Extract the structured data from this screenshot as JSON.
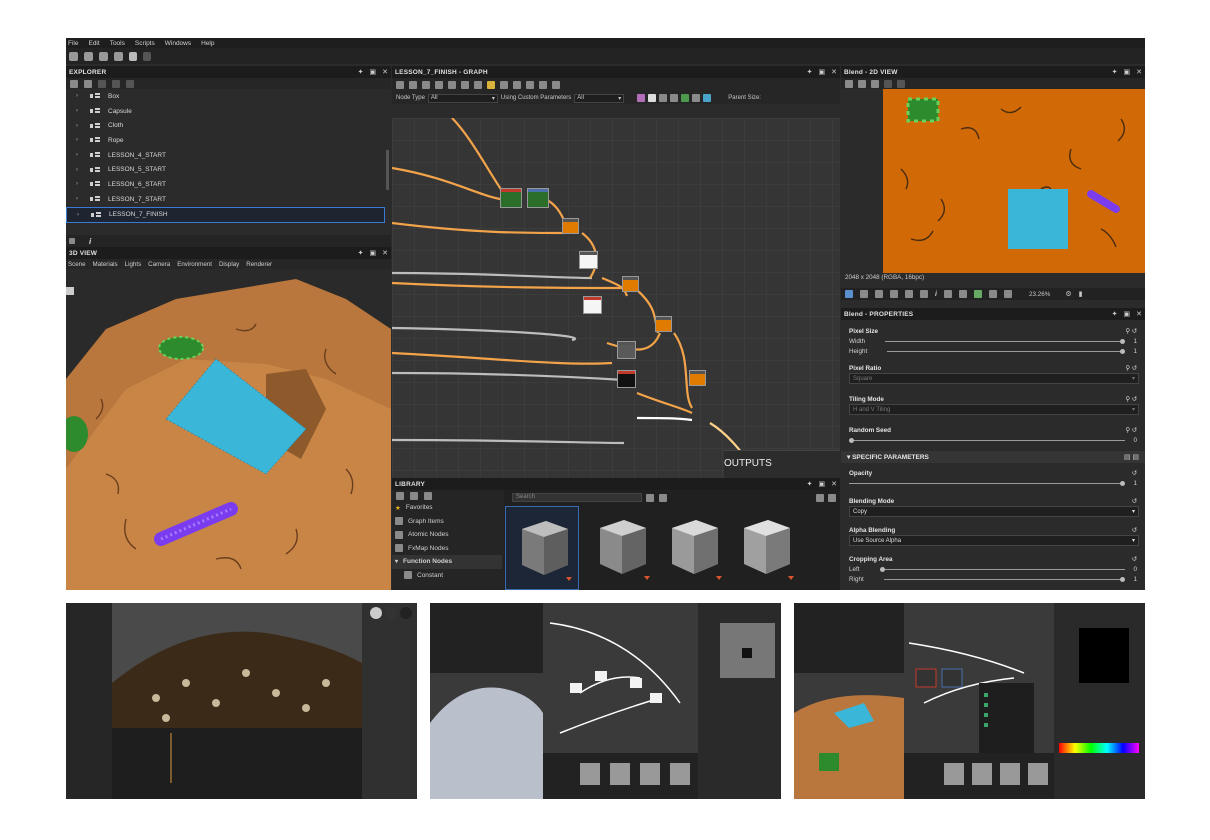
{
  "menu": [
    "File",
    "Edit",
    "Tools",
    "Scripts",
    "Windows",
    "Help"
  ],
  "explorer": {
    "title": "EXPLORER",
    "items": [
      "Box",
      "Capsule",
      "Cloth",
      "Rope",
      "LESSON_4_START",
      "LESSON_5_START",
      "LESSON_6_START",
      "LESSON_7_START",
      "LESSON_7_FINISH"
    ],
    "selected": "LESSON_7_FINISH"
  },
  "view3d": {
    "title": "3D VIEW",
    "menu": [
      "Scene",
      "Materials",
      "Lights",
      "Camera",
      "Environment",
      "Display",
      "Renderer"
    ]
  },
  "graph": {
    "title": "LESSON_7_FINISH - GRAPH",
    "node_type_label": "Node Type",
    "node_type_value": "All",
    "custom_params_label": "Using Custom Parameters",
    "custom_params_value": "All",
    "parent_size_label": "Parent Size:",
    "frame_label": "OUTPUTS"
  },
  "library": {
    "title": "LIBRARY",
    "search_placeholder": "Search",
    "items": [
      "Favorites",
      "Graph Items",
      "Atomic Nodes",
      "FxMap Nodes",
      "Function Nodes",
      "Constant"
    ]
  },
  "view2d": {
    "title": "Blend - 2D VIEW",
    "info": "2048 x 2048 (RGBA, 16bpc)",
    "zoom": "23.26%"
  },
  "properties": {
    "title": "Blend - PROPERTIES",
    "pixel_size": "Pixel Size",
    "width_label": "Width",
    "width_value": "1",
    "height_label": "Height",
    "height_value": "1",
    "pixel_ratio": "Pixel Ratio",
    "pixel_ratio_value": "Square",
    "tiling_mode": "Tiling Mode",
    "tiling_value": "H and V Tiling",
    "random_seed": "Random Seed",
    "random_seed_value": "0",
    "specific_header": "SPECIFIC PARAMETERS",
    "opacity": "Opacity",
    "opacity_value": "1",
    "blending_mode": "Blending Mode",
    "blending_value": "Copy",
    "alpha_blending": "Alpha Blending",
    "alpha_value": "Use Source Alpha",
    "cropping_area": "Cropping Area",
    "left_label": "Left",
    "left_value": "0",
    "right_label": "Right",
    "right_value": "1"
  },
  "colors": {
    "accent": "#e07b00",
    "selection": "#3a7ad6",
    "terrain": "#c07a3a",
    "cloth": "#3ab6d8"
  }
}
